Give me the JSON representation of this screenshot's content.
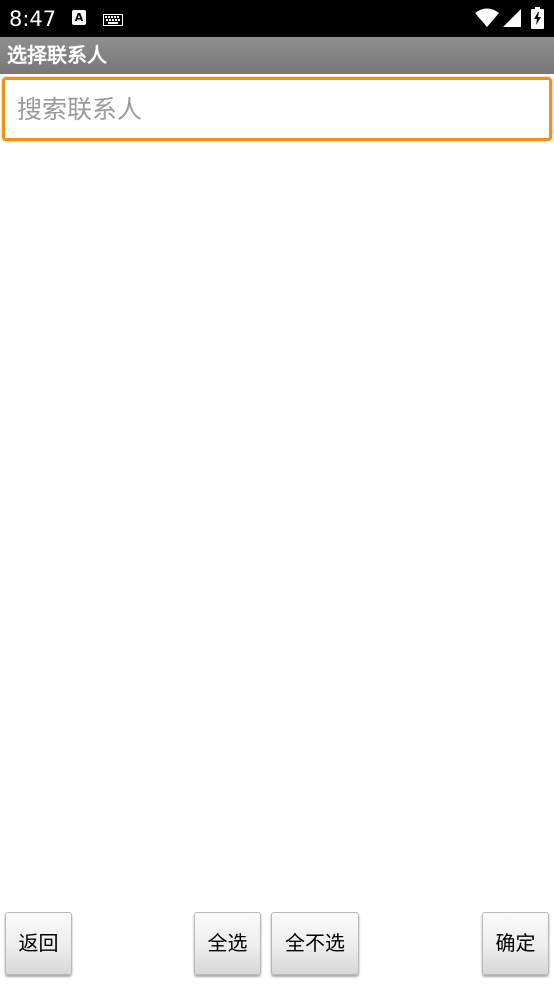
{
  "status_bar": {
    "time": "8:47",
    "notification_icon_letter": "A",
    "icons": [
      "a-app-icon",
      "keyboard-icon",
      "wifi-icon",
      "signal-icon",
      "battery-icon"
    ]
  },
  "title_bar": {
    "title": "选择联系人"
  },
  "search": {
    "placeholder": "搜索联系人",
    "value": ""
  },
  "contacts": [],
  "buttons": {
    "back": "返回",
    "select_all": "全选",
    "select_none": "全不选",
    "confirm": "确定"
  },
  "colors": {
    "status_bar_bg": "#000000",
    "title_bar_bg": "#838383",
    "search_focus_border": "#f39017",
    "background": "#ffffff"
  }
}
